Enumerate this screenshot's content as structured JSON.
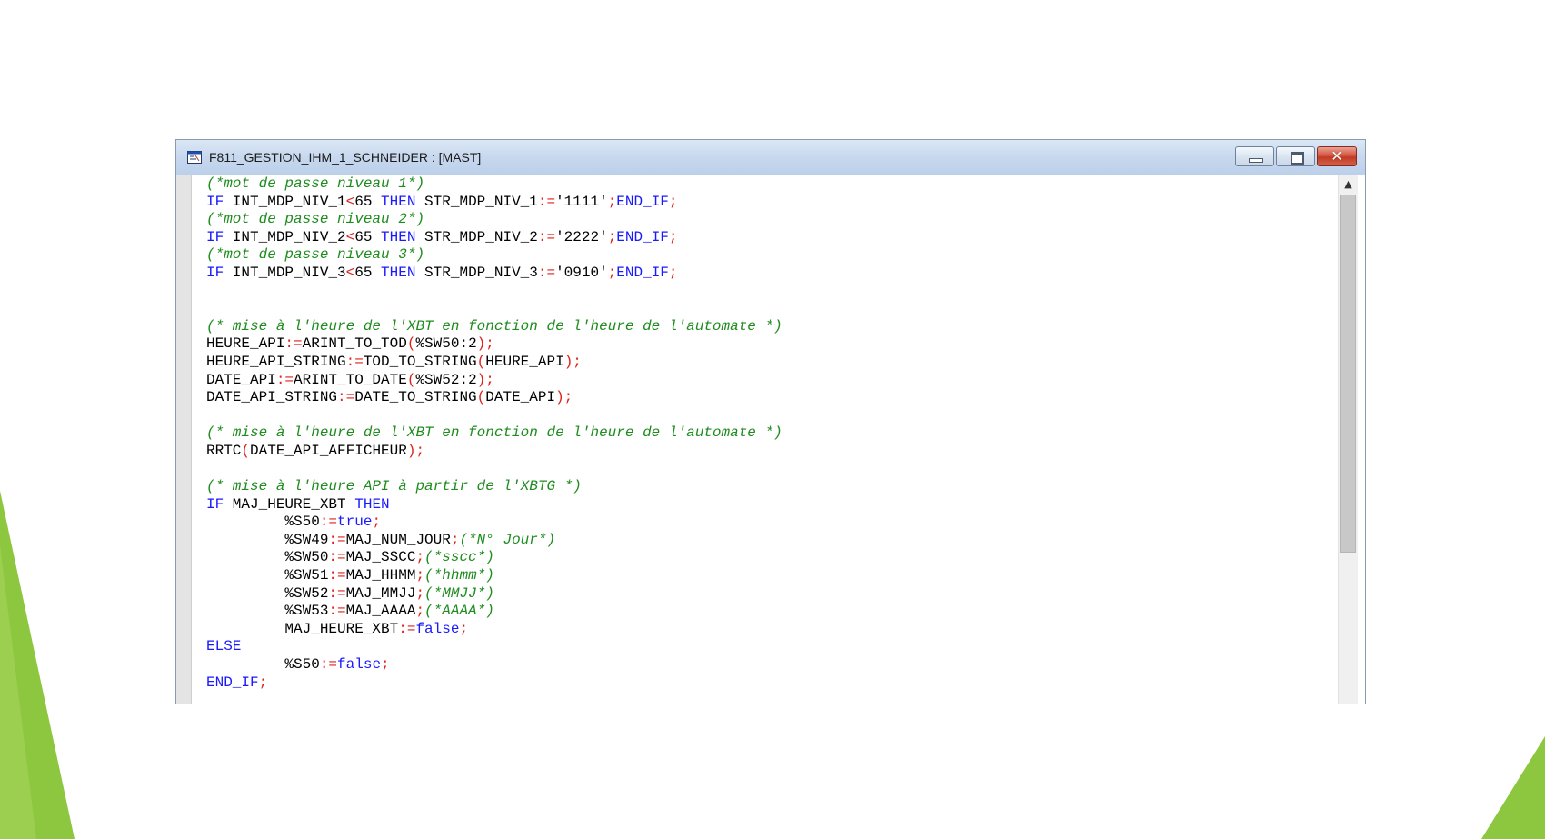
{
  "window": {
    "title": "F811_GESTION_IHM_1_SCHNEIDER : [MAST]",
    "icon": "program-section-icon"
  },
  "titlebar_buttons": {
    "minimize_icon": "minimize-icon",
    "maximize_icon": "maximize-icon",
    "close_icon": "close-icon"
  },
  "scrollbar": {
    "up_arrow_icon": "chevron-up-icon"
  },
  "colors": {
    "keyword": "#1a1aff",
    "operator": "#e0201b",
    "comment": "#1e8c1e",
    "identifier": "#000000",
    "deco_green": "#8dc63f"
  },
  "code_lines": [
    [
      {
        "t": "(*mot de passe niveau 1*)",
        "c": "cm"
      }
    ],
    [
      {
        "t": "IF",
        "c": "kw"
      },
      {
        "t": " INT_MDP_NIV_1",
        "c": "id"
      },
      {
        "t": "<",
        "c": "op"
      },
      {
        "t": "65 ",
        "c": "id"
      },
      {
        "t": "THEN",
        "c": "kw"
      },
      {
        "t": " STR_MDP_NIV_1",
        "c": "id"
      },
      {
        "t": ":=",
        "c": "op"
      },
      {
        "t": "'1111'",
        "c": "id"
      },
      {
        "t": ";",
        "c": "op"
      },
      {
        "t": "END_IF",
        "c": "kw"
      },
      {
        "t": ";",
        "c": "op"
      }
    ],
    [
      {
        "t": "(*mot de passe niveau 2*)",
        "c": "cm"
      }
    ],
    [
      {
        "t": "IF",
        "c": "kw"
      },
      {
        "t": " INT_MDP_NIV_2",
        "c": "id"
      },
      {
        "t": "<",
        "c": "op"
      },
      {
        "t": "65 ",
        "c": "id"
      },
      {
        "t": "THEN",
        "c": "kw"
      },
      {
        "t": " STR_MDP_NIV_2",
        "c": "id"
      },
      {
        "t": ":=",
        "c": "op"
      },
      {
        "t": "'2222'",
        "c": "id"
      },
      {
        "t": ";",
        "c": "op"
      },
      {
        "t": "END_IF",
        "c": "kw"
      },
      {
        "t": ";",
        "c": "op"
      }
    ],
    [
      {
        "t": "(*mot de passe niveau 3*)",
        "c": "cm"
      }
    ],
    [
      {
        "t": "IF",
        "c": "kw"
      },
      {
        "t": " INT_MDP_NIV_3",
        "c": "id"
      },
      {
        "t": "<",
        "c": "op"
      },
      {
        "t": "65 ",
        "c": "id"
      },
      {
        "t": "THEN",
        "c": "kw"
      },
      {
        "t": " STR_MDP_NIV_3",
        "c": "id"
      },
      {
        "t": ":=",
        "c": "op"
      },
      {
        "t": "'0910'",
        "c": "id"
      },
      {
        "t": ";",
        "c": "op"
      },
      {
        "t": "END_IF",
        "c": "kw"
      },
      {
        "t": ";",
        "c": "op"
      }
    ],
    [],
    [],
    [
      {
        "t": "(* mise à l'heure de l'XBT en fonction de l'heure de l'automate *)",
        "c": "cm"
      }
    ],
    [
      {
        "t": "HEURE_API",
        "c": "id"
      },
      {
        "t": ":=",
        "c": "op"
      },
      {
        "t": "ARINT_TO_TOD",
        "c": "id"
      },
      {
        "t": "(",
        "c": "op"
      },
      {
        "t": "%SW50:2",
        "c": "id"
      },
      {
        "t": ");",
        "c": "op"
      }
    ],
    [
      {
        "t": "HEURE_API_STRING",
        "c": "id"
      },
      {
        "t": ":=",
        "c": "op"
      },
      {
        "t": "TOD_TO_STRING",
        "c": "id"
      },
      {
        "t": "(",
        "c": "op"
      },
      {
        "t": "HEURE_API",
        "c": "id"
      },
      {
        "t": ");",
        "c": "op"
      }
    ],
    [
      {
        "t": "DATE_API",
        "c": "id"
      },
      {
        "t": ":=",
        "c": "op"
      },
      {
        "t": "ARINT_TO_DATE",
        "c": "id"
      },
      {
        "t": "(",
        "c": "op"
      },
      {
        "t": "%SW52:2",
        "c": "id"
      },
      {
        "t": ");",
        "c": "op"
      }
    ],
    [
      {
        "t": "DATE_API_STRING",
        "c": "id"
      },
      {
        "t": ":=",
        "c": "op"
      },
      {
        "t": "DATE_TO_STRING",
        "c": "id"
      },
      {
        "t": "(",
        "c": "op"
      },
      {
        "t": "DATE_API",
        "c": "id"
      },
      {
        "t": ");",
        "c": "op"
      }
    ],
    [],
    [
      {
        "t": "(* mise à l'heure de l'XBT en fonction de l'heure de l'automate *)",
        "c": "cm"
      }
    ],
    [
      {
        "t": "RRTC",
        "c": "id"
      },
      {
        "t": "(",
        "c": "op"
      },
      {
        "t": "DATE_API_AFFICHEUR",
        "c": "id"
      },
      {
        "t": ");",
        "c": "op"
      }
    ],
    [],
    [
      {
        "t": "(* mise à l'heure API à partir de l'XBTG *)",
        "c": "cm"
      }
    ],
    [
      {
        "t": "IF",
        "c": "kw"
      },
      {
        "t": " MAJ_HEURE_XBT ",
        "c": "id"
      },
      {
        "t": "THEN",
        "c": "kw"
      }
    ],
    [
      {
        "t": "         %S50",
        "c": "id"
      },
      {
        "t": ":=",
        "c": "op"
      },
      {
        "t": "true",
        "c": "kw"
      },
      {
        "t": ";",
        "c": "op"
      }
    ],
    [
      {
        "t": "         %SW49",
        "c": "id"
      },
      {
        "t": ":=",
        "c": "op"
      },
      {
        "t": "MAJ_NUM_JOUR",
        "c": "id"
      },
      {
        "t": ";",
        "c": "op"
      },
      {
        "t": "(*N° Jour*)",
        "c": "cm"
      }
    ],
    [
      {
        "t": "         %SW50",
        "c": "id"
      },
      {
        "t": ":=",
        "c": "op"
      },
      {
        "t": "MAJ_SSCC",
        "c": "id"
      },
      {
        "t": ";",
        "c": "op"
      },
      {
        "t": "(*sscc*)",
        "c": "cm"
      }
    ],
    [
      {
        "t": "         %SW51",
        "c": "id"
      },
      {
        "t": ":=",
        "c": "op"
      },
      {
        "t": "MAJ_HHMM",
        "c": "id"
      },
      {
        "t": ";",
        "c": "op"
      },
      {
        "t": "(*hhmm*)",
        "c": "cm"
      }
    ],
    [
      {
        "t": "         %SW52",
        "c": "id"
      },
      {
        "t": ":=",
        "c": "op"
      },
      {
        "t": "MAJ_MMJJ",
        "c": "id"
      },
      {
        "t": ";",
        "c": "op"
      },
      {
        "t": "(*MMJJ*)",
        "c": "cm"
      }
    ],
    [
      {
        "t": "         %SW53",
        "c": "id"
      },
      {
        "t": ":=",
        "c": "op"
      },
      {
        "t": "MAJ_AAAA",
        "c": "id"
      },
      {
        "t": ";",
        "c": "op"
      },
      {
        "t": "(*AAAA*)",
        "c": "cm"
      }
    ],
    [
      {
        "t": "         MAJ_HEURE_XBT",
        "c": "id"
      },
      {
        "t": ":=",
        "c": "op"
      },
      {
        "t": "false",
        "c": "kw"
      },
      {
        "t": ";",
        "c": "op"
      }
    ],
    [
      {
        "t": "ELSE",
        "c": "kw"
      }
    ],
    [
      {
        "t": "         %S50",
        "c": "id"
      },
      {
        "t": ":=",
        "c": "op"
      },
      {
        "t": "false",
        "c": "kw"
      },
      {
        "t": ";",
        "c": "op"
      }
    ],
    [
      {
        "t": "END_IF",
        "c": "kw"
      },
      {
        "t": ";",
        "c": "op"
      }
    ]
  ]
}
